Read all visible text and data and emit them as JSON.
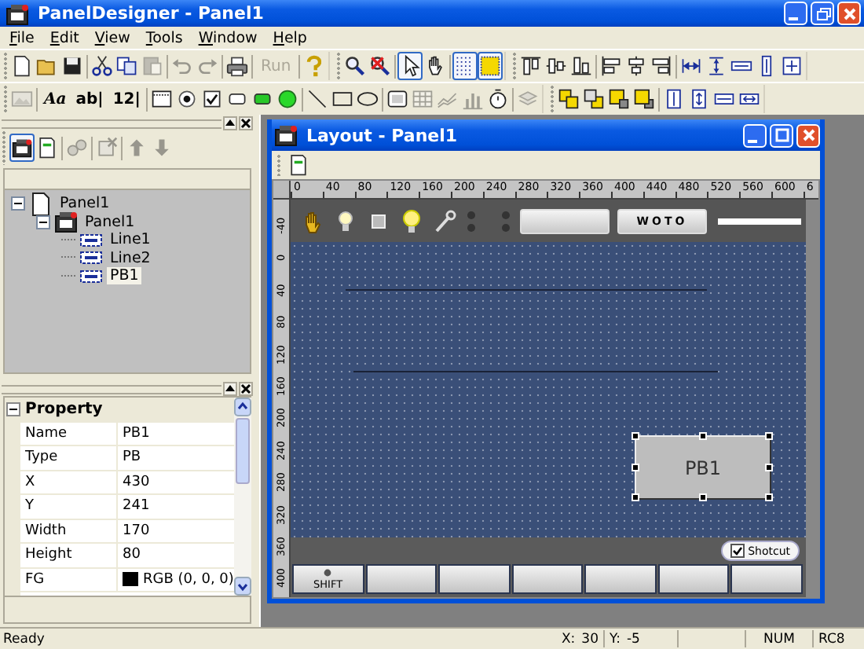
{
  "window": {
    "title": "PanelDesigner - Panel1"
  },
  "menu": [
    "File",
    "Edit",
    "View",
    "Tools",
    "Window",
    "Help"
  ],
  "toolbars": [
    {
      "bands": [
        [
          {
            "kind": "new",
            "disabled": false,
            "pressed": false
          },
          {
            "kind": "open",
            "disabled": false,
            "pressed": false
          },
          {
            "kind": "save",
            "disabled": false,
            "pressed": false
          },
          {
            "kind": "sep"
          },
          {
            "kind": "cut",
            "disabled": false,
            "pressed": false
          },
          {
            "kind": "copy",
            "disabled": false,
            "pressed": false
          },
          {
            "kind": "paste",
            "disabled": true,
            "pressed": false
          },
          {
            "kind": "sep"
          },
          {
            "kind": "undo",
            "disabled": true,
            "pressed": false
          },
          {
            "kind": "redo",
            "disabled": true,
            "pressed": false
          },
          {
            "kind": "sep"
          },
          {
            "kind": "print",
            "disabled": false,
            "pressed": false
          },
          {
            "kind": "sep"
          },
          {
            "kind": "run",
            "label": "Run",
            "disabled": true,
            "pressed": false
          },
          {
            "kind": "sep"
          },
          {
            "kind": "help",
            "disabled": false,
            "pressed": false
          }
        ],
        [
          {
            "kind": "zoom",
            "disabled": false,
            "pressed": false
          },
          {
            "kind": "zoomoff",
            "disabled": false,
            "pressed": false
          },
          {
            "kind": "sep"
          },
          {
            "kind": "pointer",
            "disabled": false,
            "pressed": true
          },
          {
            "kind": "hand",
            "disabled": false,
            "pressed": false
          },
          {
            "kind": "sep"
          },
          {
            "kind": "grid",
            "disabled": false,
            "pressed": true
          },
          {
            "kind": "snap",
            "disabled": false,
            "pressed": true
          }
        ],
        [
          {
            "kind": "aligntop",
            "disabled": false,
            "pressed": false
          },
          {
            "kind": "alignmiddle",
            "disabled": false,
            "pressed": false
          },
          {
            "kind": "alignbottom",
            "disabled": false,
            "pressed": false
          },
          {
            "kind": "sep"
          },
          {
            "kind": "alignleft",
            "disabled": false,
            "pressed": false
          },
          {
            "kind": "aligncenter",
            "disabled": false,
            "pressed": false
          },
          {
            "kind": "alignright",
            "disabled": false,
            "pressed": false
          },
          {
            "kind": "sep"
          },
          {
            "kind": "spaceh",
            "disabled": false,
            "pressed": false
          },
          {
            "kind": "spacev",
            "disabled": false,
            "pressed": false
          },
          {
            "kind": "samewidth",
            "disabled": false,
            "pressed": false
          },
          {
            "kind": "sameheight",
            "disabled": false,
            "pressed": false
          },
          {
            "kind": "samesize",
            "disabled": false,
            "pressed": false
          }
        ]
      ]
    },
    {
      "bands": [
        [
          {
            "kind": "image",
            "disabled": true,
            "pressed": false
          },
          {
            "kind": "sep"
          },
          {
            "kind": "font",
            "label": "Aa",
            "disabled": false,
            "pressed": false
          },
          {
            "kind": "textfield",
            "label": "ab|",
            "disabled": false,
            "pressed": false
          },
          {
            "kind": "numfield",
            "label": "12|",
            "disabled": false,
            "pressed": false
          },
          {
            "kind": "sep"
          },
          {
            "kind": "frame",
            "disabled": false,
            "pressed": false
          },
          {
            "kind": "radio",
            "disabled": false,
            "pressed": false
          },
          {
            "kind": "check",
            "disabled": false,
            "pressed": false
          },
          {
            "kind": "button",
            "disabled": false,
            "pressed": false
          },
          {
            "kind": "ledbutton",
            "disabled": false,
            "pressed": false
          },
          {
            "kind": "lamp",
            "disabled": false,
            "pressed": false
          },
          {
            "kind": "sep"
          },
          {
            "kind": "line",
            "disabled": false,
            "pressed": false
          },
          {
            "kind": "rect",
            "disabled": false,
            "pressed": false
          },
          {
            "kind": "ellipse",
            "disabled": false,
            "pressed": false
          },
          {
            "kind": "sep"
          },
          {
            "kind": "fkey",
            "disabled": false,
            "pressed": false
          },
          {
            "kind": "table",
            "disabled": true,
            "pressed": false
          },
          {
            "kind": "linechart",
            "disabled": true,
            "pressed": false
          },
          {
            "kind": "barchart",
            "disabled": true,
            "pressed": false
          },
          {
            "kind": "timer",
            "disabled": false,
            "pressed": false
          },
          {
            "kind": "sep"
          },
          {
            "kind": "layers",
            "disabled": true,
            "pressed": false
          }
        ],
        [
          {
            "kind": "front",
            "disabled": false,
            "pressed": false
          },
          {
            "kind": "back",
            "disabled": false,
            "pressed": false
          },
          {
            "kind": "forward",
            "disabled": false,
            "pressed": false
          },
          {
            "kind": "backward",
            "disabled": false,
            "pressed": false
          },
          {
            "kind": "sep"
          },
          {
            "kind": "centerv",
            "disabled": false,
            "pressed": false
          },
          {
            "kind": "alignv",
            "disabled": false,
            "pressed": false
          },
          {
            "kind": "centerh",
            "disabled": false,
            "pressed": false
          },
          {
            "kind": "alignh",
            "disabled": false,
            "pressed": false
          }
        ]
      ]
    }
  ],
  "object_panel": {
    "toolbar": [
      {
        "kind": "panel",
        "disabled": false,
        "pressed": true
      },
      {
        "kind": "page",
        "disabled": false,
        "pressed": false
      },
      {
        "kind": "sep"
      },
      {
        "kind": "objects",
        "disabled": true,
        "pressed": false
      },
      {
        "kind": "sep"
      },
      {
        "kind": "delete",
        "disabled": true,
        "pressed": false
      },
      {
        "kind": "sep"
      },
      {
        "kind": "up",
        "disabled": true,
        "pressed": false
      },
      {
        "kind": "down",
        "disabled": true,
        "pressed": false
      }
    ],
    "tree": [
      {
        "label": "Panel1",
        "kind": "document",
        "expanded": true,
        "selected": false,
        "children": [
          {
            "label": "Panel1",
            "kind": "panel",
            "expanded": true,
            "selected": false,
            "children": [
              {
                "label": "Line1",
                "kind": "object",
                "selected": false
              },
              {
                "label": "Line2",
                "kind": "object",
                "selected": false
              },
              {
                "label": "PB1",
                "kind": "object",
                "selected": true
              }
            ]
          }
        ]
      }
    ]
  },
  "properties": {
    "title": "Property",
    "expanded": true,
    "rows": [
      {
        "name": "Name",
        "value": "PB1"
      },
      {
        "name": "Type",
        "value": "PB"
      },
      {
        "name": "X",
        "value": "430"
      },
      {
        "name": "Y",
        "value": "241"
      },
      {
        "name": "Width",
        "value": "170"
      },
      {
        "name": "Height",
        "value": "80"
      },
      {
        "name": "FG",
        "value": "RGB (0, 0, 0)",
        "color": "#000000"
      }
    ]
  },
  "layout_window": {
    "title": "Layout - Panel1",
    "h_ruler": [
      "0",
      "40",
      "80",
      "120",
      "160",
      "200",
      "240",
      "280",
      "320",
      "360",
      "400",
      "440",
      "480",
      "520",
      "560",
      "600",
      "6"
    ],
    "v_ruler": [
      "-40",
      "0",
      "40",
      "80",
      "120",
      "160",
      "200",
      "240",
      "280",
      "320",
      "360",
      "400"
    ],
    "header": [
      {
        "kind": "hand"
      },
      {
        "kind": "smallbulb"
      },
      {
        "kind": "square"
      },
      {
        "kind": "bulb"
      },
      {
        "kind": "wrench"
      },
      {
        "kind": "indicators"
      },
      {
        "kind": "blankbutton"
      },
      {
        "kind": "button",
        "label": "WOTO"
      },
      {
        "kind": "bar"
      }
    ],
    "objects": [
      {
        "kind": "line",
        "selected": false
      },
      {
        "kind": "line",
        "selected": false
      },
      {
        "kind": "button",
        "label": "PB1",
        "selected": true
      }
    ],
    "shortcut": {
      "label": "Shotcut",
      "checked": true
    },
    "soft_keys": [
      {
        "kind": "labeled",
        "label": "SHIFT"
      },
      {
        "kind": "blank"
      },
      {
        "kind": "blank"
      },
      {
        "kind": "blank"
      },
      {
        "kind": "blank"
      },
      {
        "kind": "blank"
      },
      {
        "kind": "blank"
      }
    ]
  },
  "status_bar": {
    "message": "Ready",
    "x_label": "X:",
    "x_value": "30",
    "y_label": "Y:",
    "y_value": "-5",
    "num": "NUM",
    "mode": "RC8"
  }
}
